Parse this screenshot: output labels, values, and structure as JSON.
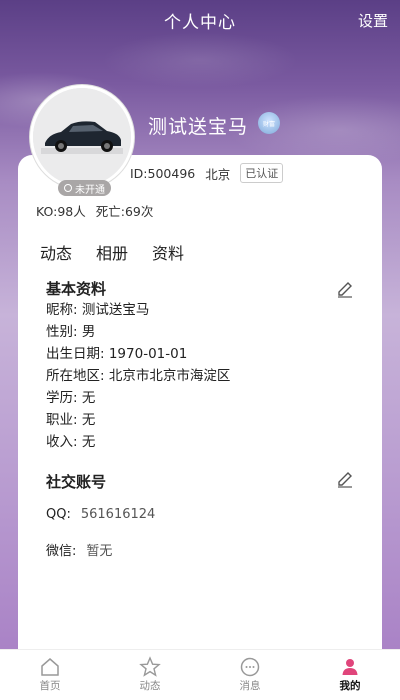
{
  "header": {
    "title": "个人中心",
    "settings_label": "设置"
  },
  "profile": {
    "avatar_badge": "未开通",
    "username": "测试送宝马",
    "vip_badge_text": "财富",
    "id_text": "ID:500496",
    "city": "北京",
    "verified_label": "已认证",
    "ko_text": "KO:98人",
    "death_text": "死亡:69次"
  },
  "tabs": [
    "动态",
    "相册",
    "资料"
  ],
  "basic_info": {
    "title": "基本资料",
    "rows": [
      "昵称:  测试送宝马",
      "性别:  男",
      "出生日期:  1970-01-01",
      "所在地区:  北京市北京市海淀区",
      "学历:  无",
      "职业:  无",
      "收入:  无"
    ]
  },
  "social": {
    "title": "社交账号",
    "qq_label": "QQ:",
    "qq_value": "561616124",
    "wechat_label": "微信:",
    "wechat_value": "暂无"
  },
  "bottom_nav": [
    {
      "label": "首页",
      "icon": "home-icon"
    },
    {
      "label": "动态",
      "icon": "star-icon"
    },
    {
      "label": "消息",
      "icon": "message-icon"
    },
    {
      "label": "我的",
      "icon": "person-icon"
    }
  ],
  "colors": {
    "accent": "#e0457b",
    "header_purple": "#5b3f86"
  }
}
